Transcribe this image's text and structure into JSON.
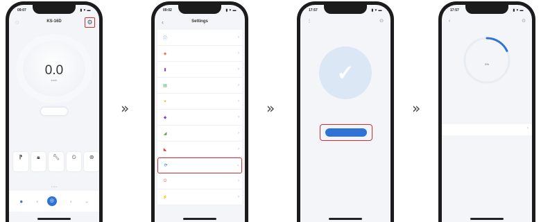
{
  "colors": {
    "accent": "#2f73d8",
    "highlight": "#d92b2b"
  },
  "arrows": [
    "»",
    "»",
    "»"
  ],
  "phone1": {
    "time": "09:07",
    "signal": "▮ ▾ ▬",
    "back_icon": "◌",
    "title": "KS-16D",
    "gear_icon": "⚙",
    "speed_value": "0.0",
    "speed_unit": "km/h",
    "pill_label": "",
    "left_label": "",
    "right_label": "",
    "sub_label": "",
    "controls": [
      {
        "icon": "⁋",
        "label": ""
      },
      {
        "icon": "🔒︎",
        "label": ""
      },
      {
        "icon": "🔧︎",
        "label": ""
      },
      {
        "icon": "⏲",
        "label": ""
      },
      {
        "icon": "⊛",
        "label": ""
      }
    ],
    "dots": "• • •",
    "tabs": [
      {
        "icon": "●",
        "label": ""
      },
      {
        "icon": "◐",
        "label": ""
      },
      {
        "icon": "◎",
        "label": ""
      },
      {
        "icon": "◑",
        "label": ""
      },
      {
        "icon": "◒",
        "label": ""
      }
    ]
  },
  "phone2": {
    "time": "09:02",
    "signal": "▮ ▾ ▬",
    "back_icon": "‹",
    "title": "Settings",
    "items": [
      {
        "icon": "ⓘ",
        "color": "#2f73d8",
        "label": "",
        "value": ""
      },
      {
        "icon": "◈",
        "color": "#e0572b",
        "label": "",
        "value": ""
      },
      {
        "icon": "▮",
        "color": "#8b4cc9",
        "label": "",
        "value": ""
      },
      {
        "icon": "▤",
        "color": "#3aa85b",
        "label": "",
        "value": ""
      },
      {
        "icon": "✦",
        "color": "#f0b429",
        "label": "",
        "value": ""
      },
      {
        "icon": "◆",
        "color": "#8b4cc9",
        "label": "",
        "value": ""
      },
      {
        "icon": "◢",
        "color": "#5aa83a",
        "label": "",
        "value": ""
      },
      {
        "icon": "◣",
        "color": "#e03b2b",
        "label": "",
        "value": ""
      },
      {
        "icon": "⟳",
        "color": "#2f73d8",
        "label": "",
        "value": ""
      },
      {
        "icon": "⏻",
        "color": "#e0572b",
        "label": "",
        "value": ""
      },
      {
        "icon": "⚡",
        "color": "#3aa85b",
        "label": "",
        "value": ""
      }
    ]
  },
  "phone3": {
    "time": "17:57",
    "signal": "▮ ▾ ▬",
    "left_icon": "⋮",
    "title": "",
    "right_icon": "⊙",
    "check_icon": "✓",
    "message": "",
    "update_label": "",
    "version": ""
  },
  "phone4": {
    "time": "17:57",
    "signal": "▮ ▾ ▬",
    "left_icon": "‹",
    "title": "",
    "right_icon": "⊙",
    "progress_pct": "0%",
    "progress_fraction": 0.18,
    "status": "",
    "row_label": "",
    "row_chev": "›",
    "version": ""
  }
}
